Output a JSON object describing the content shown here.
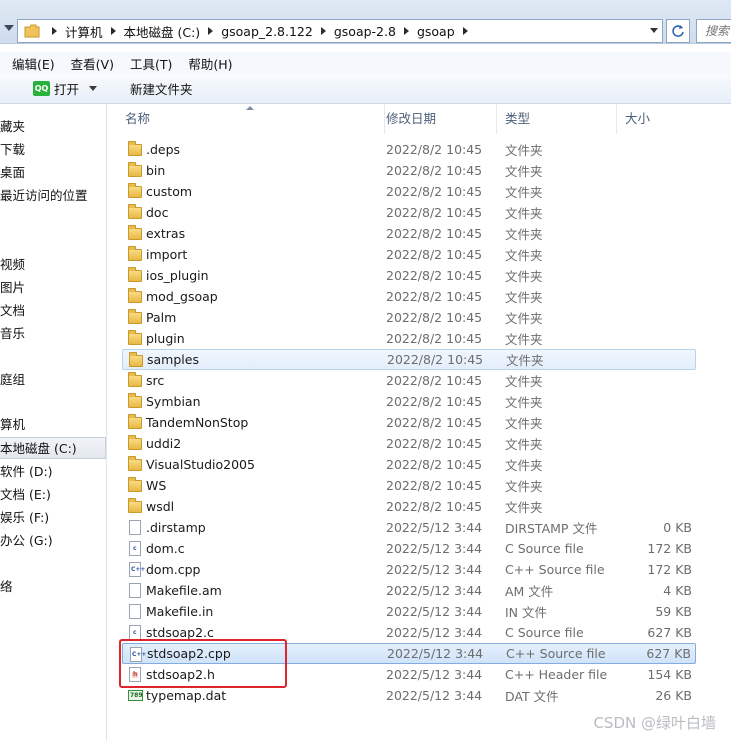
{
  "address": {
    "crumbs": [
      "计算机",
      "本地磁盘 (C:)",
      "gsoap_2.8.122",
      "gsoap-2.8",
      "gsoap"
    ],
    "search_placeholder": "搜索"
  },
  "menu": [
    "编辑(E)",
    "查看(V)",
    "工具(T)",
    "帮助(H)"
  ],
  "toolbar": {
    "open_icon_text": "QQ",
    "open_label": "打开",
    "new_folder_label": "新建文件夹"
  },
  "sidebar": {
    "items": [
      "藏夹",
      "下载",
      "桌面",
      "最近访问的位置",
      "",
      "视频",
      "图片",
      "文档",
      "音乐",
      "庭组",
      "算机",
      "本地磁盘 (C:)",
      "软件 (D:)",
      "文档 (E:)",
      "娱乐 (F:)",
      "办公 (G:)",
      "络"
    ]
  },
  "columns": {
    "name": "名称",
    "date": "修改日期",
    "type": "类型",
    "size": "大小"
  },
  "files": [
    {
      "name": ".deps",
      "date": "2022/8/2 10:45",
      "type": "文件夹",
      "size": "",
      "icon": "folder-icon"
    },
    {
      "name": "bin",
      "date": "2022/8/2 10:45",
      "type": "文件夹",
      "size": "",
      "icon": "folder-icon"
    },
    {
      "name": "custom",
      "date": "2022/8/2 10:45",
      "type": "文件夹",
      "size": "",
      "icon": "folder-icon"
    },
    {
      "name": "doc",
      "date": "2022/8/2 10:45",
      "type": "文件夹",
      "size": "",
      "icon": "folder-icon"
    },
    {
      "name": "extras",
      "date": "2022/8/2 10:45",
      "type": "文件夹",
      "size": "",
      "icon": "folder-icon"
    },
    {
      "name": "import",
      "date": "2022/8/2 10:45",
      "type": "文件夹",
      "size": "",
      "icon": "folder-icon"
    },
    {
      "name": "ios_plugin",
      "date": "2022/8/2 10:45",
      "type": "文件夹",
      "size": "",
      "icon": "folder-icon"
    },
    {
      "name": "mod_gsoap",
      "date": "2022/8/2 10:45",
      "type": "文件夹",
      "size": "",
      "icon": "folder-icon"
    },
    {
      "name": "Palm",
      "date": "2022/8/2 10:45",
      "type": "文件夹",
      "size": "",
      "icon": "folder-icon"
    },
    {
      "name": "plugin",
      "date": "2022/8/2 10:45",
      "type": "文件夹",
      "size": "",
      "icon": "folder-icon"
    },
    {
      "name": "samples",
      "date": "2022/8/2 10:45",
      "type": "文件夹",
      "size": "",
      "icon": "folder-icon",
      "state": "hover"
    },
    {
      "name": "src",
      "date": "2022/8/2 10:45",
      "type": "文件夹",
      "size": "",
      "icon": "folder-icon"
    },
    {
      "name": "Symbian",
      "date": "2022/8/2 10:45",
      "type": "文件夹",
      "size": "",
      "icon": "folder-icon"
    },
    {
      "name": "TandemNonStop",
      "date": "2022/8/2 10:45",
      "type": "文件夹",
      "size": "",
      "icon": "folder-icon"
    },
    {
      "name": "uddi2",
      "date": "2022/8/2 10:45",
      "type": "文件夹",
      "size": "",
      "icon": "folder-icon"
    },
    {
      "name": "VisualStudio2005",
      "date": "2022/8/2 10:45",
      "type": "文件夹",
      "size": "",
      "icon": "folder-icon"
    },
    {
      "name": "WS",
      "date": "2022/8/2 10:45",
      "type": "文件夹",
      "size": "",
      "icon": "folder-icon"
    },
    {
      "name": "wsdl",
      "date": "2022/8/2 10:45",
      "type": "文件夹",
      "size": "",
      "icon": "folder-icon"
    },
    {
      "name": ".dirstamp",
      "date": "2022/5/12 3:44",
      "type": "DIRSTAMP 文件",
      "size": "0 KB",
      "icon": "blank-file-icon"
    },
    {
      "name": "dom.c",
      "date": "2022/5/12 3:44",
      "type": "C Source file",
      "size": "172 KB",
      "icon": "c-file-icon",
      "icon_text": "c"
    },
    {
      "name": "dom.cpp",
      "date": "2022/5/12 3:44",
      "type": "C++ Source file",
      "size": "172 KB",
      "icon": "cpp-file-icon",
      "icon_text": "C++"
    },
    {
      "name": "Makefile.am",
      "date": "2022/5/12 3:44",
      "type": "AM 文件",
      "size": "4 KB",
      "icon": "blank-file-icon"
    },
    {
      "name": "Makefile.in",
      "date": "2022/5/12 3:44",
      "type": "IN 文件",
      "size": "59 KB",
      "icon": "blank-file-icon"
    },
    {
      "name": "stdsoap2.c",
      "date": "2022/5/12 3:44",
      "type": "C Source file",
      "size": "627 KB",
      "icon": "c-file-icon",
      "icon_text": "c"
    },
    {
      "name": "stdsoap2.cpp",
      "date": "2022/5/12 3:44",
      "type": "C++ Source file",
      "size": "627 KB",
      "icon": "cpp-file-icon",
      "icon_text": "C++",
      "state": "selected"
    },
    {
      "name": "stdsoap2.h",
      "date": "2022/5/12 3:44",
      "type": "C++ Header file",
      "size": "154 KB",
      "icon": "h-file-icon",
      "icon_text": "h"
    },
    {
      "name": "typemap.dat",
      "date": "2022/5/12 3:44",
      "type": "DAT 文件",
      "size": "26 KB",
      "icon": "dat-file-icon",
      "icon_text": "789"
    }
  ],
  "watermark": "CSDN @绿叶白墙",
  "colors": {
    "annotation_red": "#e0252a",
    "selection_border": "#84acdd",
    "hover_border": "#b9d2ee",
    "folder_yellow": "#e9b845"
  }
}
